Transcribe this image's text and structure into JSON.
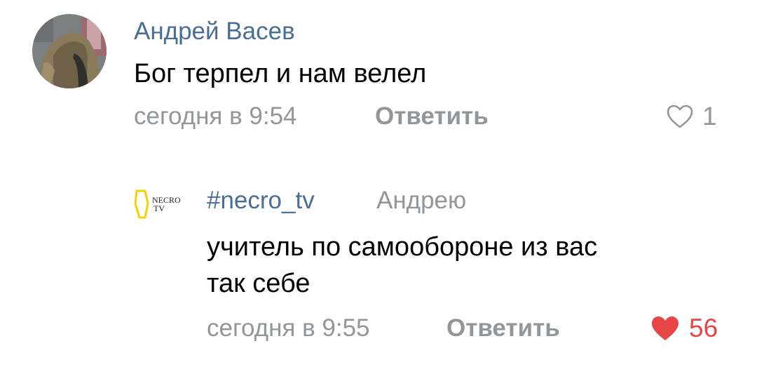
{
  "comments": [
    {
      "author": "Андрей Васев",
      "text": "Бог терпел и нам велел",
      "time": "сегодня в 9:54",
      "reply_label": "Ответить",
      "likes": "1",
      "liked": false
    },
    {
      "author": "#necro_tv",
      "reply_to": "Андрею",
      "text_lines": [
        "учитель по самообороне из вас",
        "так себе"
      ],
      "time": "сегодня в 9:55",
      "reply_label": "Ответить",
      "likes": "56",
      "liked": true,
      "avatar_logo": {
        "line1": "NECRO",
        "line2": "TV",
        "color": "#f2d300"
      }
    }
  ],
  "colors": {
    "author_link": "#4a6e96",
    "meta_gray": "#939699",
    "like_active": "#e64646",
    "like_inactive": "#939699"
  }
}
